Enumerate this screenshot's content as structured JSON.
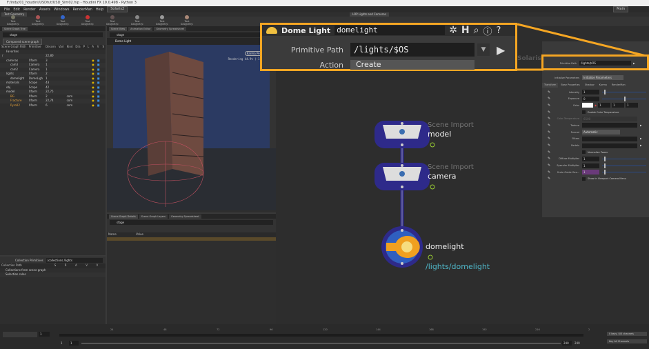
{
  "window": {
    "title": "F:/indy/01_houdini/USDtut/USD_Sim02.hip - Houdini FX 19.0.498 - Python 3"
  },
  "menu": [
    "File",
    "Edit",
    "Render",
    "Assets",
    "Windows",
    "RenderMan",
    "Help"
  ],
  "desktop": "Solaris2",
  "desktop_right": "Main",
  "shelf": {
    "tabs": [
      "Test Geometry"
    ],
    "tools": [
      "Test Geometry: C...",
      "Test Geometry: P...",
      "Test Geometry: R...",
      "Test Geometry: S...",
      "Test Geometry: S...",
      "Test Geometry: T...",
      "Test Geometry: T...",
      "Test Geometry: T..."
    ],
    "right_tab": "LOP Lights and Cameras"
  },
  "scene_graph_tree": {
    "tab": "Scene Graph Tree",
    "path": "stage",
    "mode": "Composed scene graph",
    "columns": [
      "Scene Graph Path",
      "Primitive",
      "Descen",
      "Vari",
      "Kind",
      "Dra",
      "P",
      "L",
      "A",
      "V",
      "S"
    ],
    "rows": [
      {
        "name": "Favorites",
        "prim": "",
        "desc": "",
        "kind": "",
        "depth": 1
      },
      {
        "name": "/",
        "prim": "",
        "desc": "22,80",
        "kind": "",
        "depth": 0
      },
      {
        "name": "cameras",
        "prim": "Xform",
        "desc": "3",
        "kind": "",
        "depth": 1
      },
      {
        "name": "cam3",
        "prim": "Camera",
        "desc": "1",
        "kind": "",
        "depth": 2
      },
      {
        "name": "cam2",
        "prim": "Camera",
        "desc": "1",
        "kind": "",
        "depth": 2
      },
      {
        "name": "lights",
        "prim": "Xform",
        "desc": "2",
        "kind": "",
        "depth": 1
      },
      {
        "name": "domelight",
        "prim": "DomeLigh",
        "desc": "1",
        "kind": "",
        "depth": 2
      },
      {
        "name": "materials",
        "prim": "Scope",
        "desc": "43",
        "kind": "",
        "depth": 1
      },
      {
        "name": "obj",
        "prim": "Scope",
        "desc": "42",
        "kind": "",
        "depth": 1
      },
      {
        "name": "model",
        "prim": "Xform",
        "desc": "22,75",
        "kind": "",
        "depth": 1
      },
      {
        "name": "BG",
        "prim": "Xform",
        "desc": "2",
        "kind": "com",
        "depth": 2,
        "highlight": true
      },
      {
        "name": "Fracture",
        "prim": "Xform",
        "desc": "22,74",
        "kind": "com",
        "depth": 2,
        "highlight": true
      },
      {
        "name": "Pyro02",
        "prim": "Xform",
        "desc": "6",
        "kind": "com",
        "depth": 2,
        "highlight": true
      }
    ]
  },
  "collections": {
    "label": "Collection Primitives",
    "value": "/collections /lights",
    "columns": [
      "Collection Path",
      "S",
      "R",
      "A",
      "V",
      "V"
    ],
    "items": [
      "Collections from scene graph",
      "Selection rules"
    ]
  },
  "viewport": {
    "tabs": [
      "Scene View",
      "Animation Editor",
      "Geometry Spreadsheet"
    ],
    "path": "stage",
    "node": "Dome Light",
    "renderer": "Karma Persp",
    "status": "Rendering   44.9%   (-1:22)"
  },
  "details": {
    "tabs": [
      "Scene Graph Details",
      "Scene Graph Layers",
      "Geometry Spreadsheet"
    ],
    "path": "stage",
    "columns": [
      "Name",
      "Value"
    ]
  },
  "network": {
    "label": "Solaris",
    "nodes": [
      {
        "type": "Scene Import",
        "name": "model"
      },
      {
        "type": "Scene Import",
        "name": "camera"
      },
      {
        "type": "",
        "name": "domelight",
        "path": "/lights/domelight"
      }
    ]
  },
  "callout": {
    "node_type": "Dome Light",
    "node_name": "domelight",
    "primitive_path_label": "Primitive Path",
    "primitive_path": "/lights/$OS",
    "action_label": "Action",
    "action": "Create"
  },
  "params": {
    "primitive_path_label": "Primitive Path",
    "primitive_path": "/lights/$OS",
    "init_label": "Initialize Parameters",
    "init_value": "Initialize Parameters",
    "tabs": [
      "Transform",
      "Base Properties",
      "Shadow",
      "Karma",
      "RenderMan"
    ],
    "rows": [
      {
        "label": "Intensity",
        "value": "1",
        "slider": 0.05
      },
      {
        "label": "Exposure",
        "value": "0",
        "slider": 0.5
      },
      {
        "label": "Color",
        "value": "1",
        "value2": "1",
        "value3": "1"
      },
      {
        "label": "",
        "check": "Enable Color Temperature"
      },
      {
        "label": "Color Temperature",
        "value": "6500",
        "disabled": true
      },
      {
        "label": "Texture",
        "value": ""
      },
      {
        "label": "Format",
        "value": "Automatic"
      },
      {
        "label": "Filters",
        "value": ""
      },
      {
        "label": "Portals",
        "value": ""
      },
      {
        "label": "",
        "check": "Normalize Power"
      },
      {
        "label": "Diffuse Multiplier",
        "value": "1",
        "slider": 0.05
      },
      {
        "label": "Specular Multiplier",
        "value": "1",
        "slider": 0.05
      },
      {
        "label": "Scale Guide Geo...",
        "value": "1",
        "slider": 0.05
      },
      {
        "label": "",
        "check": "Show in Viewport Camera Menu"
      }
    ]
  },
  "timeline": {
    "frame": "1",
    "start": "1",
    "start2": "1",
    "end": "240",
    "end2": "240",
    "ticks": [
      "24",
      "48",
      "72",
      "96",
      "120",
      "144",
      "168",
      "192",
      "216",
      "2"
    ],
    "keys_label": "0 keys, 0/0 channels",
    "keyall_label": "Key All Channels"
  },
  "colors": {
    "accent": "#f5a623",
    "node_selected": "#2e2a8a",
    "path_text": "#4fb6c8"
  }
}
